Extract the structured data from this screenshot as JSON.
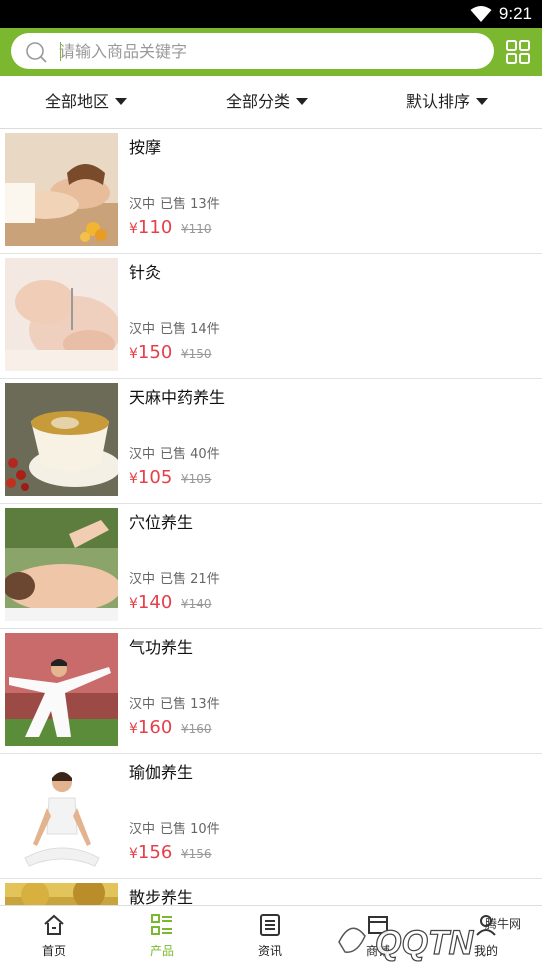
{
  "status_bar": {
    "time": "9:21",
    "wifi_icon": "wifi-icon"
  },
  "search": {
    "placeholder": "请输入商品关键字",
    "value": ""
  },
  "filters": [
    {
      "label": "全部地区"
    },
    {
      "label": "全部分类"
    },
    {
      "label": "默认排序"
    }
  ],
  "products": [
    {
      "name": "按摩",
      "region": "汉中",
      "sold": "已售 13件",
      "price": "110",
      "original_price": "¥110"
    },
    {
      "name": "针灸",
      "region": "汉中",
      "sold": "已售 14件",
      "price": "150",
      "original_price": "¥150"
    },
    {
      "name": "天麻中药养生",
      "region": "汉中",
      "sold": "已售 40件",
      "price": "105",
      "original_price": "¥105"
    },
    {
      "name": "穴位养生",
      "region": "汉中",
      "sold": "已售 21件",
      "price": "140",
      "original_price": "¥140"
    },
    {
      "name": "气功养生",
      "region": "汉中",
      "sold": "已售 13件",
      "price": "160",
      "original_price": "¥160"
    },
    {
      "name": "瑜伽养生",
      "region": "汉中",
      "sold": "已售 10件",
      "price": "156",
      "original_price": "¥156"
    },
    {
      "name": "散步养生",
      "region": "",
      "sold": "",
      "price": "",
      "original_price": ""
    }
  ],
  "currency": "¥",
  "tabs": [
    {
      "label": "首页",
      "icon": "home-icon"
    },
    {
      "label": "产品",
      "icon": "product-list-icon",
      "active": true
    },
    {
      "label": "资讯",
      "icon": "news-icon"
    },
    {
      "label": "商铺",
      "icon": "shop-icon"
    },
    {
      "label": "我的",
      "icon": "user-icon"
    }
  ],
  "watermark": {
    "text": "QQTN",
    "subtext": "腾牛网"
  },
  "colors": {
    "accent": "#7cb82f",
    "price": "#e5404a",
    "status_bar": "#000000"
  }
}
